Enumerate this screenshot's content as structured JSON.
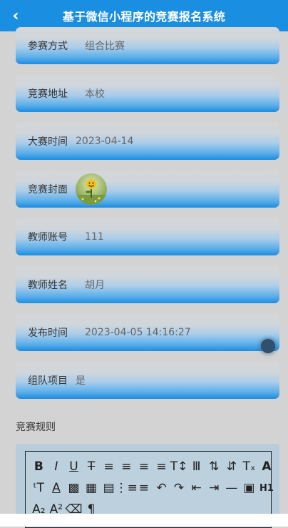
{
  "header": {
    "title": "基于微信小程序的竞赛报名系统",
    "back_icon": "chevron-left-icon"
  },
  "fields": [
    {
      "label": "参赛方式",
      "value": "组合比赛"
    },
    {
      "label": "竞赛地址",
      "value": "本校"
    },
    {
      "label": "大赛时间",
      "value": "2023-04-14"
    },
    {
      "label": "竞赛封面",
      "image": "smiley-flower-cover"
    },
    {
      "label": "教师账号",
      "value": "111"
    },
    {
      "label": "教师姓名",
      "value": "胡月"
    },
    {
      "label": "发布时间",
      "value": "2023-04-05 14:16:27"
    },
    {
      "label": "组队项目",
      "value": "是"
    }
  ],
  "rules": {
    "label": "竞赛规则"
  },
  "toolbar": {
    "row1": [
      "bold-icon",
      "italic-icon",
      "underline-icon",
      "strikethrough-icon",
      "align-left-icon",
      "align-center-icon",
      "align-right-icon",
      "align-justify-icon",
      "font-size-icon",
      "format-clear-cursor-icon",
      "line-height-up-icon",
      "line-height-down-icon",
      "remove-format-icon",
      "font-icon"
    ],
    "row2": [
      "text-size-icon",
      "font-color-icon",
      "background-color-icon",
      "date-icon",
      "clipboard-icon",
      "ordered-list-icon",
      "bullet-list-icon",
      "undo-icon",
      "redo-icon",
      "outdent-icon",
      "indent-icon",
      "horizontal-rule-icon",
      "image-icon",
      "heading-icon"
    ],
    "row3": [
      "subscript-icon",
      "superscript-icon",
      "delete-icon",
      "paragraph-icon"
    ],
    "heading_text": "H1"
  },
  "colors": {
    "header": "#1a8ee0",
    "page": "#d3d3d3",
    "accent": "#1d8ce0"
  }
}
